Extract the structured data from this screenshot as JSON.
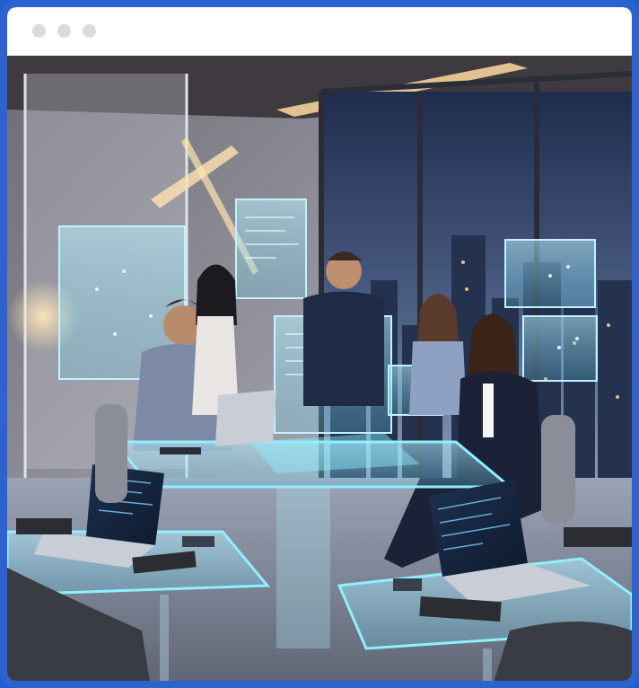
{
  "window": {
    "controls": [
      "window-dot-1",
      "window-dot-2",
      "window-dot-3"
    ]
  },
  "photo": {
    "subject": "office-photo",
    "colors": {
      "sky_top": "#1d2a4a",
      "sky_bottom": "#7f8fb3",
      "glow": "#8be9ff",
      "accent": "#2c63cf"
    }
  }
}
